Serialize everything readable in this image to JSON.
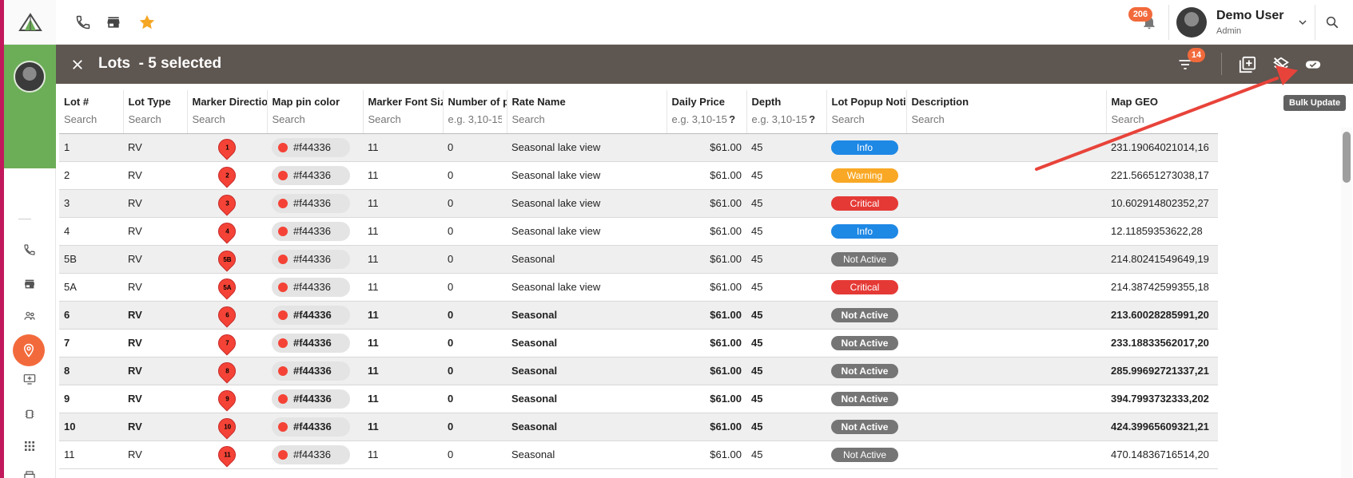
{
  "topbar": {
    "notifications_count": "206",
    "user_name": "Demo User",
    "user_role": "Admin"
  },
  "selection": {
    "title": "Lots  - 5 selected",
    "filter_count": "14",
    "tooltip": "Bulk Update"
  },
  "table": {
    "columns": [
      {
        "label": "Lot #",
        "placeholder": "Search"
      },
      {
        "label": "Lot Type",
        "placeholder": "Search"
      },
      {
        "label": "Marker Direction",
        "placeholder": "Search"
      },
      {
        "label": "Map pin color",
        "placeholder": "Search"
      },
      {
        "label": "Marker Font Size",
        "placeholder": "Search"
      },
      {
        "label": "Number of people",
        "placeholder": "e.g. 3,10-15"
      },
      {
        "label": "Rate Name",
        "placeholder": "Search"
      },
      {
        "label": "Daily Price",
        "placeholder": "e.g. 3,10-15,"
      },
      {
        "label": "Depth",
        "placeholder": "e.g. 3,10-15,"
      },
      {
        "label": "Lot Popup Notification",
        "placeholder": "Search"
      },
      {
        "label": "Description",
        "placeholder": "Search"
      },
      {
        "label": "Map GEO",
        "placeholder": "Search"
      }
    ],
    "rows": [
      {
        "lot": "1",
        "type": "RV",
        "marker": "1",
        "color": "#f44336",
        "font": "11",
        "people": "0",
        "rate": "Seasonal lake view",
        "price": "$61.00",
        "depth": "45",
        "status": "Info",
        "status_color": "#1e88e5",
        "desc": "",
        "geo": "231.19064021014,16",
        "selected": false
      },
      {
        "lot": "2",
        "type": "RV",
        "marker": "2",
        "color": "#f44336",
        "font": "11",
        "people": "0",
        "rate": "Seasonal lake view",
        "price": "$61.00",
        "depth": "45",
        "status": "Warning",
        "status_color": "#f9a825",
        "desc": "",
        "geo": "221.56651273038,17",
        "selected": false
      },
      {
        "lot": "3",
        "type": "RV",
        "marker": "3",
        "color": "#f44336",
        "font": "11",
        "people": "0",
        "rate": "Seasonal lake view",
        "price": "$61.00",
        "depth": "45",
        "status": "Critical",
        "status_color": "#e53935",
        "desc": "",
        "geo": "10.602914802352,27",
        "selected": false
      },
      {
        "lot": "4",
        "type": "RV",
        "marker": "4",
        "color": "#f44336",
        "font": "11",
        "people": "0",
        "rate": "Seasonal lake view",
        "price": "$61.00",
        "depth": "45",
        "status": "Info",
        "status_color": "#1e88e5",
        "desc": "",
        "geo": "12.11859353622,28",
        "selected": false
      },
      {
        "lot": "5B",
        "type": "RV",
        "marker": "5B",
        "color": "#f44336",
        "font": "11",
        "people": "0",
        "rate": "Seasonal",
        "price": "$61.00",
        "depth": "45",
        "status": "Not Active",
        "status_color": "#757575",
        "desc": "",
        "geo": "214.80241549649,19",
        "selected": false
      },
      {
        "lot": "5A",
        "type": "RV",
        "marker": "5A",
        "color": "#f44336",
        "font": "11",
        "people": "0",
        "rate": "Seasonal lake view",
        "price": "$61.00",
        "depth": "45",
        "status": "Critical",
        "status_color": "#e53935",
        "desc": "",
        "geo": "214.38742599355,18",
        "selected": false
      },
      {
        "lot": "6",
        "type": "RV",
        "marker": "6",
        "color": "#f44336",
        "font": "11",
        "people": "0",
        "rate": "Seasonal",
        "price": "$61.00",
        "depth": "45",
        "status": "Not Active",
        "status_color": "#757575",
        "desc": "",
        "geo": "213.60028285991,20",
        "selected": true
      },
      {
        "lot": "7",
        "type": "RV",
        "marker": "7",
        "color": "#f44336",
        "font": "11",
        "people": "0",
        "rate": "Seasonal",
        "price": "$61.00",
        "depth": "45",
        "status": "Not Active",
        "status_color": "#757575",
        "desc": "",
        "geo": "233.18833562017,20",
        "selected": true
      },
      {
        "lot": "8",
        "type": "RV",
        "marker": "8",
        "color": "#f44336",
        "font": "11",
        "people": "0",
        "rate": "Seasonal",
        "price": "$61.00",
        "depth": "45",
        "status": "Not Active",
        "status_color": "#757575",
        "desc": "",
        "geo": "285.99692721337,21",
        "selected": true
      },
      {
        "lot": "9",
        "type": "RV",
        "marker": "9",
        "color": "#f44336",
        "font": "11",
        "people": "0",
        "rate": "Seasonal",
        "price": "$61.00",
        "depth": "45",
        "status": "Not Active",
        "status_color": "#757575",
        "desc": "",
        "geo": "394.7993732333,202",
        "selected": true
      },
      {
        "lot": "10",
        "type": "RV",
        "marker": "10",
        "color": "#f44336",
        "font": "11",
        "people": "0",
        "rate": "Seasonal",
        "price": "$61.00",
        "depth": "45",
        "status": "Not Active",
        "status_color": "#757575",
        "desc": "",
        "geo": "424.39965609321,21",
        "selected": true
      },
      {
        "lot": "11",
        "type": "RV",
        "marker": "11",
        "color": "#f44336",
        "font": "11",
        "people": "0",
        "rate": "Seasonal",
        "price": "$61.00",
        "depth": "45",
        "status": "Not Active",
        "status_color": "#757575",
        "desc": "",
        "geo": "470.14836716514,20",
        "selected": false
      }
    ]
  },
  "colors": {
    "accent": "#f26a3c",
    "header_bg": "#5e5650",
    "sidebar_green": "#6cae57",
    "annotation_arrow": "#e8433a"
  },
  "icons": {
    "topbar": [
      "phone-icon",
      "store-icon",
      "star-icon",
      "bell-icon",
      "chevron-down-icon",
      "search-icon"
    ],
    "selection": [
      "close-icon",
      "filter-icon",
      "add-box-icon",
      "layers-off-icon",
      "bulk-update-icon"
    ],
    "sidebar": [
      "phone-icon",
      "store-icon",
      "people-icon",
      "map-pin-icon",
      "add-to-queue-icon",
      "chip-icon",
      "apps-icon",
      "printer-icon"
    ]
  }
}
